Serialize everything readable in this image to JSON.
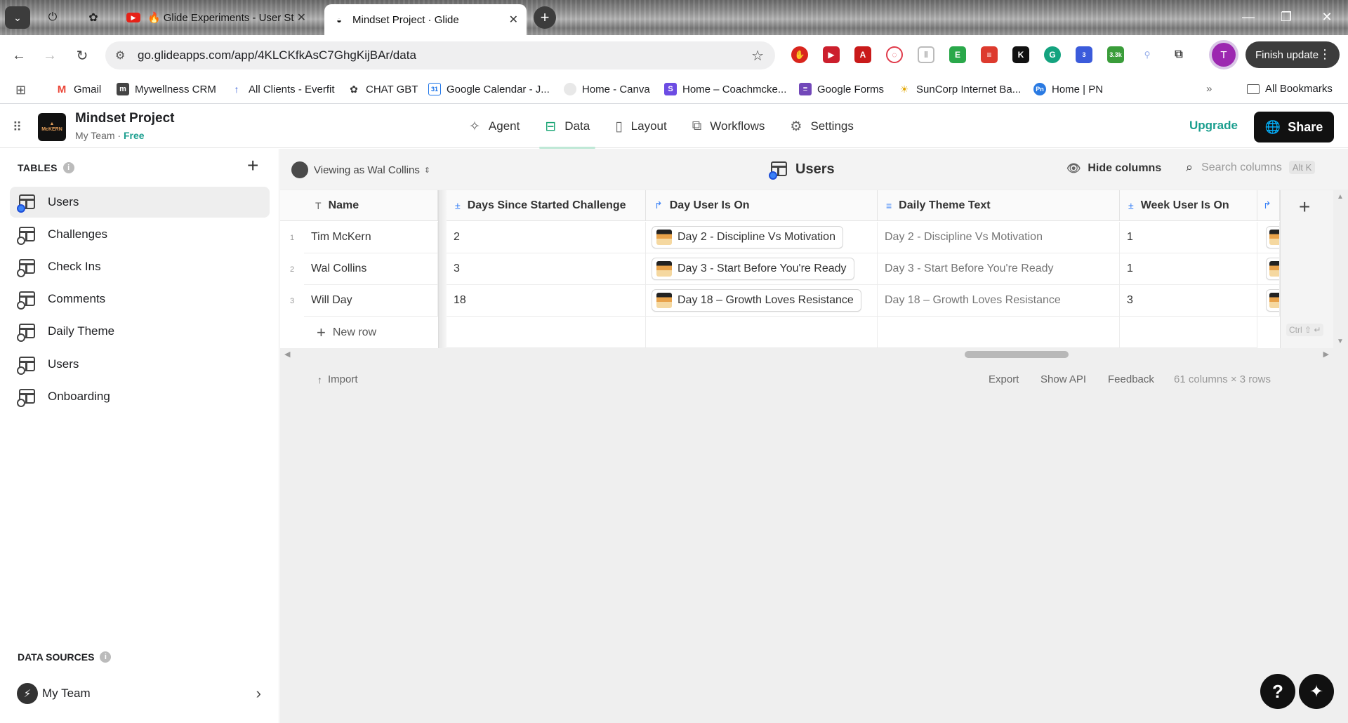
{
  "browser": {
    "tabs": [
      {
        "title": "Glide Experiments - User St",
        "active": false
      },
      {
        "title": "Mindset Project · Glide",
        "active": true
      }
    ],
    "url": "go.glideapps.com/app/4KLCKfkAsC7GhgKijBAr/data",
    "profile_initial": "T",
    "finish_update_label": "Finish update",
    "extension_badges": {
      "badge_3": "3",
      "badge_33k": "3.3k"
    },
    "bookmarks": [
      "Gmail",
      "Mywellness CRM",
      "All Clients - Everfit",
      "CHAT GBT",
      "Google Calendar - J...",
      "Home - Canva",
      "Home – Coachmcke...",
      "Google Forms",
      "SunCorp Internet Ba...",
      "Home | PN"
    ],
    "all_bookmarks_label": "All Bookmarks"
  },
  "app": {
    "logo_text": "McKERN",
    "project_name": "Mindset Project",
    "team": "My Team · ",
    "plan": "Free",
    "nav": [
      {
        "label": "Agent",
        "icon": "sparkle-icon"
      },
      {
        "label": "Data",
        "icon": "table-icon",
        "active": true
      },
      {
        "label": "Layout",
        "icon": "layout-icon"
      },
      {
        "label": "Workflows",
        "icon": "workflow-icon"
      },
      {
        "label": "Settings",
        "icon": "gear-icon"
      }
    ],
    "upgrade_label": "Upgrade",
    "share_label": "Share"
  },
  "sidebar": {
    "tables_heading": "TABLES",
    "tables": [
      "Users",
      "Challenges",
      "Check Ins",
      "Comments",
      "Daily Theme",
      "Users",
      "Onboarding"
    ],
    "data_sources_heading": "DATA SOURCES",
    "data_source": "My Team"
  },
  "viewbar": {
    "viewing_as": "Viewing as Wal Collins",
    "table_title": "Users",
    "hide_columns": "Hide columns",
    "search_placeholder": "Search columns",
    "search_shortcut": "Alt K"
  },
  "grid": {
    "columns": [
      "Name",
      "Days Since Started Challenge",
      "Day User Is On",
      "Daily Theme Text",
      "Week User Is On"
    ],
    "rows": [
      {
        "num": "1",
        "name": "Tim McKern",
        "days": "2",
        "day_on": "Day 2 - Discipline Vs Motivation",
        "theme": "Day 2 - Discipline Vs Motivation",
        "week": "1"
      },
      {
        "num": "2",
        "name": "Wal Collins",
        "days": "3",
        "day_on": "Day 3 - Start Before You're Ready",
        "theme": "Day 3 - Start Before You're Ready",
        "week": "1"
      },
      {
        "num": "3",
        "name": "Will Day",
        "days": "18",
        "day_on": "Day 18 – Growth Loves Resistance",
        "theme": "Day 18 – Growth Loves Resistance",
        "week": "3"
      }
    ],
    "new_row_label": "New row",
    "new_row_shortcut": "Ctrl ⇧ ↵"
  },
  "footer": {
    "import": "Import",
    "export": "Export",
    "show_api": "Show API",
    "feedback": "Feedback",
    "summary": "61 columns × 3 rows"
  },
  "colors": {
    "accent": "#1a9e8e",
    "data_tab": "#19a574",
    "dark": "#111111"
  }
}
